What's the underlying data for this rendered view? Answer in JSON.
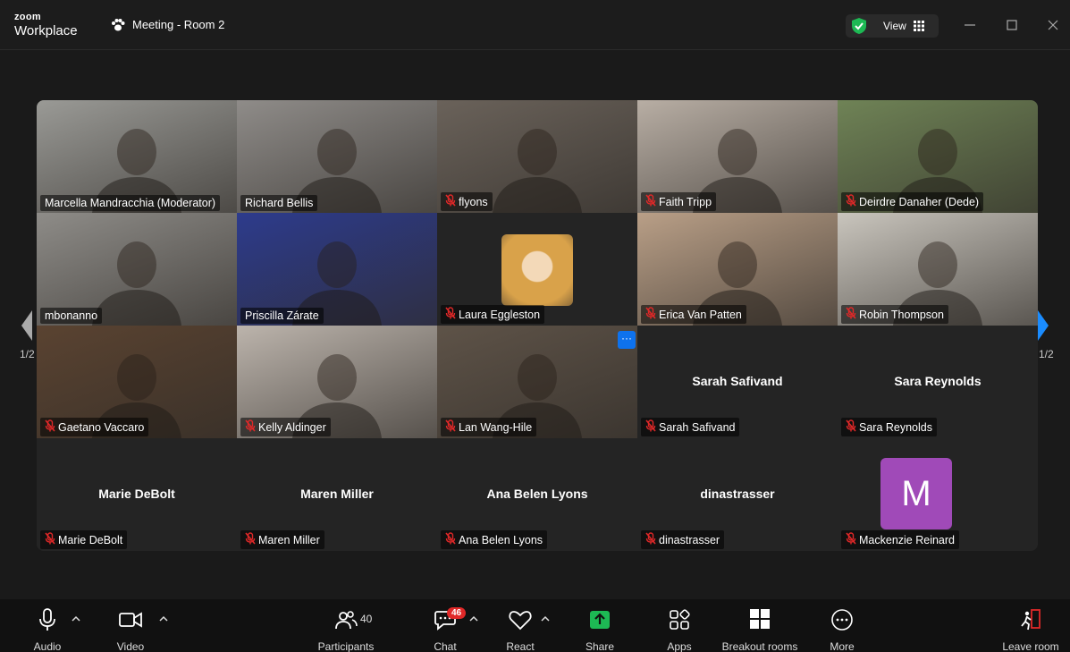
{
  "app": {
    "brand_top": "zoom",
    "brand_bottom": "Workplace",
    "meeting_title": "Meeting - Room 2"
  },
  "header": {
    "view_label": "View"
  },
  "colors": {
    "accent": "#0e72ed",
    "active_speaker": "#3fd39a",
    "mute": "#e02828",
    "avatar_m": "#a04ab8"
  },
  "tiles": [
    {
      "name": "Marcella Mandracchia (Moderator)",
      "muted": false,
      "kind": "video",
      "bg": "#9a9a96"
    },
    {
      "name": "Richard Bellis",
      "muted": false,
      "kind": "video",
      "bg": "#8f8c89"
    },
    {
      "name": "flyons",
      "muted": true,
      "kind": "video",
      "bg": "#6a625a"
    },
    {
      "name": "Faith Tripp",
      "muted": true,
      "kind": "video",
      "bg": "#b8aea4"
    },
    {
      "name": "Deirdre Danaher (Dede)",
      "muted": true,
      "kind": "video",
      "bg": "#6f8356"
    },
    {
      "name": "mbonanno",
      "muted": false,
      "kind": "video",
      "bg": "#8e8c88"
    },
    {
      "name": "Priscilla Zárate",
      "muted": false,
      "kind": "video",
      "bg": "#2d3b8c",
      "active": true
    },
    {
      "name": "Laura Eggleston",
      "muted": true,
      "kind": "photo",
      "bg": "#242424"
    },
    {
      "name": "Erica Van Patten",
      "muted": true,
      "kind": "video",
      "bg": "#b99f87"
    },
    {
      "name": "Robin Thompson",
      "muted": true,
      "kind": "video",
      "bg": "#c9c5bd"
    },
    {
      "name": "Gaetano Vaccaro",
      "muted": true,
      "kind": "video",
      "bg": "#5a4331"
    },
    {
      "name": "Kelly Aldinger",
      "muted": true,
      "kind": "video",
      "bg": "#bcb4ac"
    },
    {
      "name": "Lan Wang-Hile",
      "muted": true,
      "kind": "video",
      "bg": "#5e5348",
      "more": true
    },
    {
      "name": "Sarah Safivand",
      "muted": true,
      "kind": "name",
      "center": "Sarah Safivand"
    },
    {
      "name": "Sara Reynolds",
      "muted": true,
      "kind": "name",
      "center": "Sara Reynolds"
    },
    {
      "name": "Marie DeBolt",
      "muted": true,
      "kind": "name",
      "center": "Marie DeBolt"
    },
    {
      "name": "Maren Miller",
      "muted": true,
      "kind": "name",
      "center": "Maren Miller"
    },
    {
      "name": "Ana Belen Lyons",
      "muted": true,
      "kind": "name",
      "center": "Ana Belen Lyons"
    },
    {
      "name": "dinastrasser",
      "muted": true,
      "kind": "name",
      "center": "dinastrasser"
    },
    {
      "name": "Mackenzie Reinard",
      "muted": true,
      "kind": "avatar",
      "initial": "M"
    }
  ],
  "pager": {
    "left": "1/2",
    "right": "1/2"
  },
  "more_icon_text": "···",
  "toolbar": {
    "audio": "Audio",
    "video": "Video",
    "participants": "Participants",
    "participants_count": "40",
    "chat": "Chat",
    "chat_badge": "46",
    "react": "React",
    "share": "Share",
    "apps": "Apps",
    "breakout": "Breakout rooms",
    "more": "More",
    "leave": "Leave room"
  }
}
